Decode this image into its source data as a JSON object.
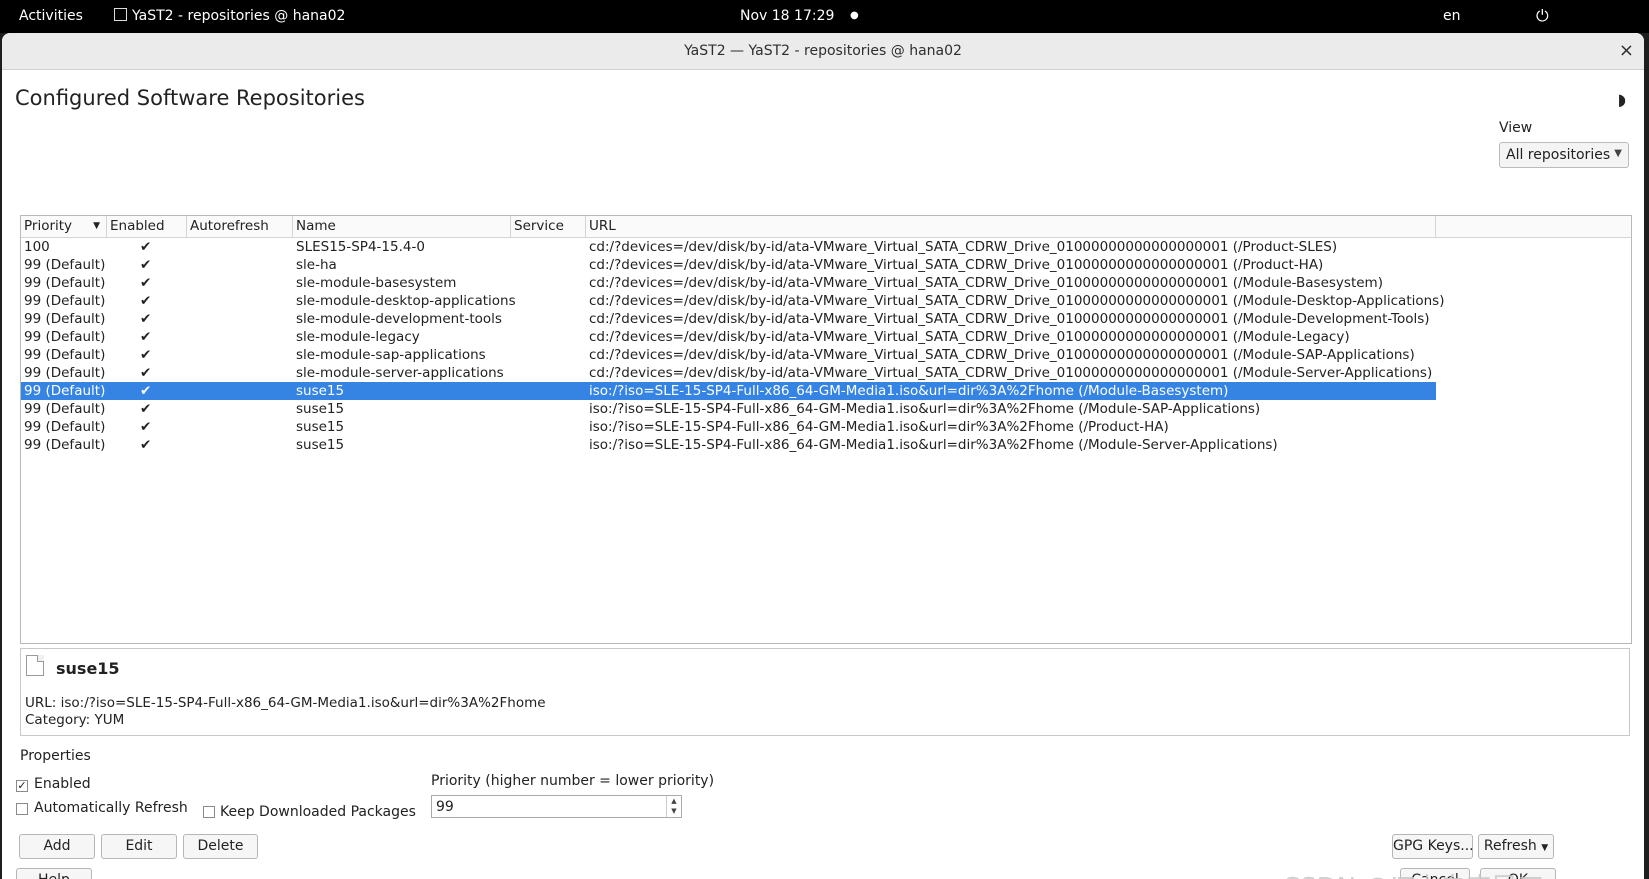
{
  "topbar": {
    "activities": "Activities",
    "app_title": "YaST2 - repositories @ hana02",
    "datetime": "Nov 18  17:29",
    "lang": "en"
  },
  "window": {
    "title": "YaST2 — YaST2 - repositories @ hana02",
    "close": "×"
  },
  "page_title": "Configured Software Repositories",
  "view": {
    "label": "View",
    "selected": "All repositories"
  },
  "table": {
    "columns": [
      "Priority",
      "Enabled",
      "Autorefresh",
      "Name",
      "Service",
      "URL"
    ],
    "rows": [
      {
        "priority": "100",
        "enabled": "✔",
        "autorefresh": "",
        "name": "SLES15-SP4-15.4-0",
        "service": "",
        "url": "cd:/?devices=/dev/disk/by-id/ata-VMware_Virtual_SATA_CDRW_Drive_01000000000000000001 (/Product-SLES)"
      },
      {
        "priority": "99 (Default)",
        "enabled": "✔",
        "autorefresh": "",
        "name": "sle-ha",
        "service": "",
        "url": "cd:/?devices=/dev/disk/by-id/ata-VMware_Virtual_SATA_CDRW_Drive_01000000000000000001 (/Product-HA)"
      },
      {
        "priority": "99 (Default)",
        "enabled": "✔",
        "autorefresh": "",
        "name": "sle-module-basesystem",
        "service": "",
        "url": "cd:/?devices=/dev/disk/by-id/ata-VMware_Virtual_SATA_CDRW_Drive_01000000000000000001 (/Module-Basesystem)"
      },
      {
        "priority": "99 (Default)",
        "enabled": "✔",
        "autorefresh": "",
        "name": "sle-module-desktop-applications",
        "service": "",
        "url": "cd:/?devices=/dev/disk/by-id/ata-VMware_Virtual_SATA_CDRW_Drive_01000000000000000001 (/Module-Desktop-Applications)"
      },
      {
        "priority": "99 (Default)",
        "enabled": "✔",
        "autorefresh": "",
        "name": "sle-module-development-tools",
        "service": "",
        "url": "cd:/?devices=/dev/disk/by-id/ata-VMware_Virtual_SATA_CDRW_Drive_01000000000000000001 (/Module-Development-Tools)"
      },
      {
        "priority": "99 (Default)",
        "enabled": "✔",
        "autorefresh": "",
        "name": "sle-module-legacy",
        "service": "",
        "url": "cd:/?devices=/dev/disk/by-id/ata-VMware_Virtual_SATA_CDRW_Drive_01000000000000000001 (/Module-Legacy)"
      },
      {
        "priority": "99 (Default)",
        "enabled": "✔",
        "autorefresh": "",
        "name": "sle-module-sap-applications",
        "service": "",
        "url": "cd:/?devices=/dev/disk/by-id/ata-VMware_Virtual_SATA_CDRW_Drive_01000000000000000001 (/Module-SAP-Applications)"
      },
      {
        "priority": "99 (Default)",
        "enabled": "✔",
        "autorefresh": "",
        "name": "sle-module-server-applications",
        "service": "",
        "url": "cd:/?devices=/dev/disk/by-id/ata-VMware_Virtual_SATA_CDRW_Drive_01000000000000000001 (/Module-Server-Applications)"
      },
      {
        "priority": "99 (Default)",
        "enabled": "✔",
        "autorefresh": "",
        "name": "suse15",
        "service": "",
        "url": "iso:/?iso=SLE-15-SP4-Full-x86_64-GM-Media1.iso&url=dir%3A%2Fhome (/Module-Basesystem)",
        "selected": true
      },
      {
        "priority": "99 (Default)",
        "enabled": "✔",
        "autorefresh": "",
        "name": "suse15",
        "service": "",
        "url": "iso:/?iso=SLE-15-SP4-Full-x86_64-GM-Media1.iso&url=dir%3A%2Fhome (/Module-SAP-Applications)"
      },
      {
        "priority": "99 (Default)",
        "enabled": "✔",
        "autorefresh": "",
        "name": "suse15",
        "service": "",
        "url": "iso:/?iso=SLE-15-SP4-Full-x86_64-GM-Media1.iso&url=dir%3A%2Fhome (/Product-HA)"
      },
      {
        "priority": "99 (Default)",
        "enabled": "✔",
        "autorefresh": "",
        "name": "suse15",
        "service": "",
        "url": "iso:/?iso=SLE-15-SP4-Full-x86_64-GM-Media1.iso&url=dir%3A%2Fhome (/Module-Server-Applications)"
      }
    ]
  },
  "detail": {
    "name": "suse15",
    "url_line": "URL: iso:/?iso=SLE-15-SP4-Full-x86_64-GM-Media1.iso&url=dir%3A%2Fhome",
    "category_line": "Category: YUM"
  },
  "properties": {
    "label": "Properties",
    "enabled": {
      "label": "Enabled",
      "checked": true
    },
    "auto_refresh": {
      "label": "Automatically Refresh",
      "checked": false
    },
    "keep_packages": {
      "label": "Keep Downloaded Packages",
      "checked": false
    },
    "priority_label": "Priority (higher number = lower priority)",
    "priority_value": "99"
  },
  "buttons": {
    "add": "Add",
    "edit": "Edit",
    "delete": "Delete",
    "gpg": "GPG Keys...",
    "refresh": "Refresh",
    "help": "Help",
    "cancel": "Cancel",
    "ok": "OK"
  },
  "watermark": "CSDN @IT小白农民工",
  "colors": {
    "selection": "#3584e4",
    "topbar": "#000000"
  }
}
